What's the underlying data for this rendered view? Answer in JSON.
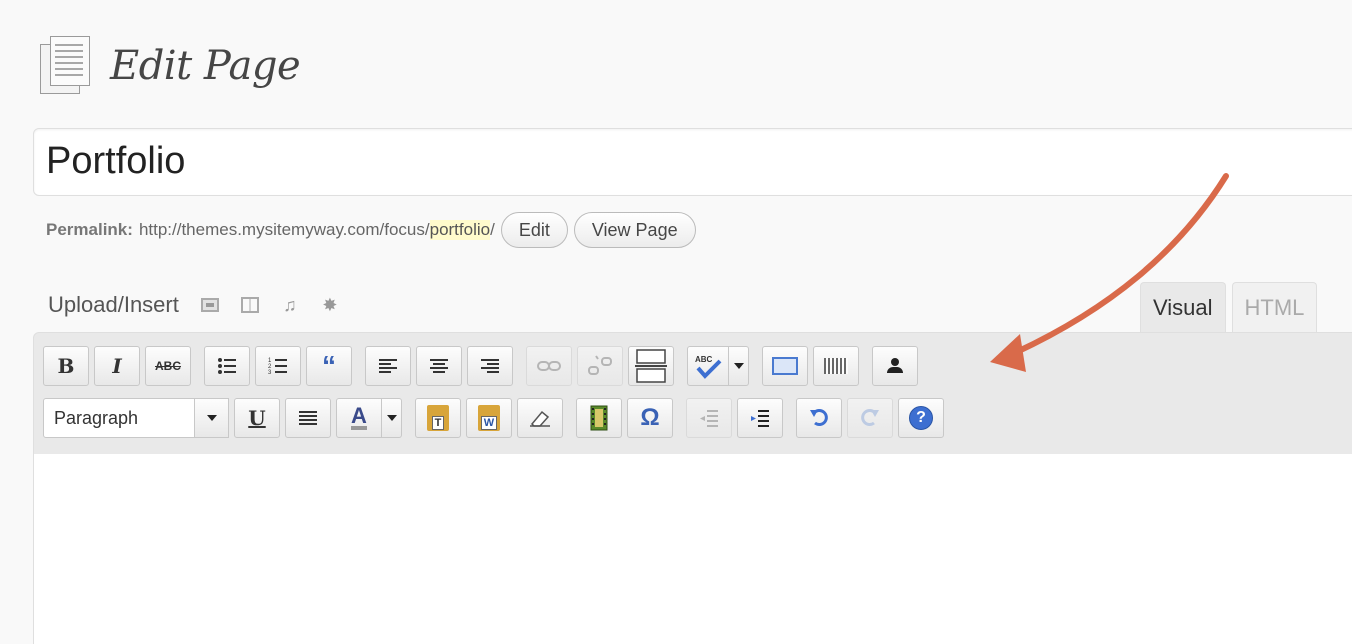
{
  "header": {
    "title": "Edit Page",
    "icon": "pages-icon"
  },
  "title_field": {
    "value": "Portfolio"
  },
  "permalink": {
    "label": "Permalink:",
    "base": "http://themes.mysitemyway.com/focus/",
    "slug": "portfolio",
    "trailing": "/",
    "edit_label": "Edit",
    "view_label": "View Page"
  },
  "upload": {
    "label": "Upload/Insert",
    "icons": [
      "add-image-icon",
      "add-gallery-icon",
      "add-audio-icon",
      "add-media-icon"
    ]
  },
  "tabs": [
    {
      "label": "Visual"
    },
    {
      "label": "HTML"
    }
  ],
  "toolbar": {
    "row1": [
      "bold",
      "italic",
      "strikethrough",
      "bullet-list",
      "numbered-list",
      "blockquote",
      "align-left",
      "align-center",
      "align-right",
      "insert-link",
      "unlink",
      "insert-more",
      "spellcheck",
      "fullscreen",
      "kitchen-sink",
      "custom-shortcode"
    ],
    "format_select": "Paragraph",
    "row2": [
      "underline",
      "justify",
      "text-color",
      "paste-text",
      "paste-word",
      "remove-format",
      "insert-media",
      "special-char",
      "outdent",
      "indent",
      "undo",
      "redo",
      "help"
    ],
    "labels": {
      "bold": "B",
      "italic": "I",
      "strike": "ABC",
      "quote": "“",
      "underline": "U",
      "textcolor": "A",
      "omega": "Ω",
      "help": "?",
      "paste_text": "T",
      "paste_word": "W",
      "spell": "ABC"
    }
  },
  "colors": {
    "arrow": "#d96a4a",
    "accent_blue": "#3d6fd1",
    "slug_highlight": "#fffbcc"
  }
}
